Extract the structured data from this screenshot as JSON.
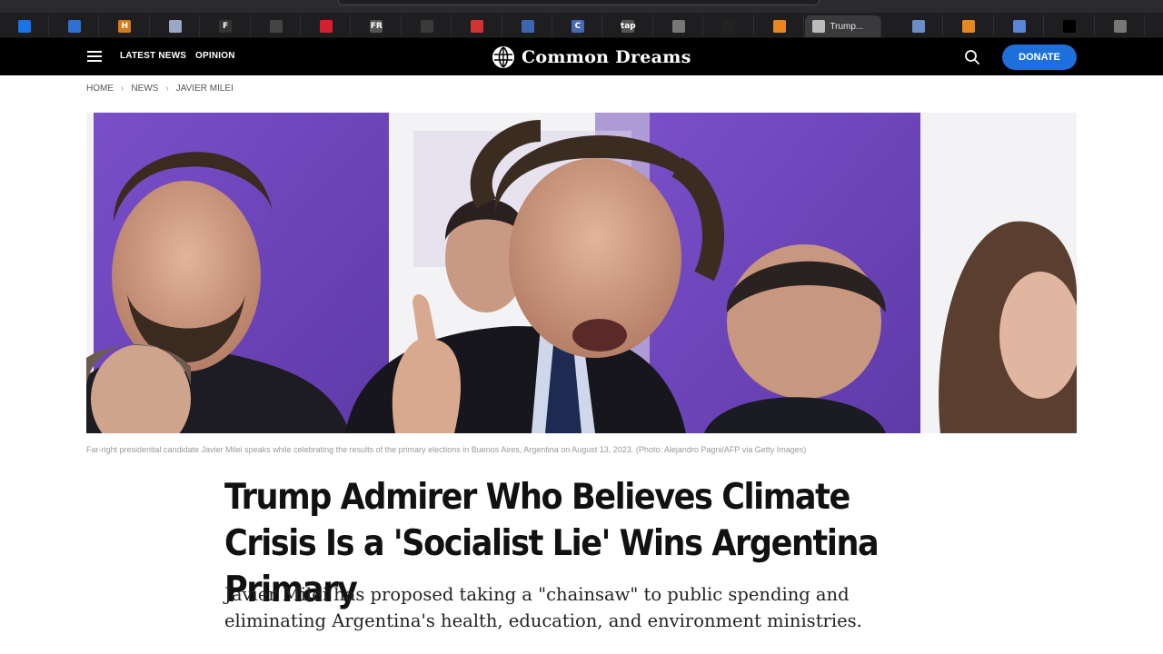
{
  "browser": {
    "tabs": [
      {
        "icon": "shield-icon",
        "color": "#1a73e8",
        "glyph": "",
        "active": false
      },
      {
        "icon": "shield-icon",
        "color": "#2f6fd6",
        "glyph": "",
        "active": false
      },
      {
        "icon": "h-logo-icon",
        "color": "#d77a1c",
        "glyph": "H",
        "active": false
      },
      {
        "icon": "news-icon",
        "color": "#9aa7c7",
        "glyph": "",
        "active": false
      },
      {
        "icon": "f-logo-icon",
        "color": "#333333",
        "glyph": "F",
        "active": false
      },
      {
        "icon": "newspaper-icon",
        "color": "#444444",
        "glyph": "",
        "active": false
      },
      {
        "icon": "red-logo-icon",
        "color": "#d5212f",
        "glyph": "",
        "active": false
      },
      {
        "icon": "fr-logo-icon",
        "color": "#555555",
        "glyph": "FR",
        "active": false
      },
      {
        "icon": "check-icon",
        "color": "#3a3a3a",
        "glyph": "",
        "active": false
      },
      {
        "icon": "red-square-icon",
        "color": "#d43333",
        "glyph": "",
        "active": false
      },
      {
        "icon": "book-icon",
        "color": "#3b67b0",
        "glyph": "",
        "active": false
      },
      {
        "icon": "c-logo-icon",
        "color": "#486ab3",
        "glyph": "C",
        "active": false
      },
      {
        "icon": "tap-logo-icon",
        "color": "#555555",
        "glyph": "tap",
        "active": false
      },
      {
        "icon": "globe-icon",
        "color": "#777777",
        "glyph": "",
        "active": false
      },
      {
        "icon": "dots-icon",
        "color": "#222222",
        "glyph": "",
        "active": false
      },
      {
        "icon": "orange-square-icon",
        "color": "#e8871e",
        "glyph": "",
        "active": false
      },
      {
        "icon": "common-dreams-icon",
        "color": "#bbbbbb",
        "glyph": "",
        "active": true,
        "title": "Trump..."
      },
      {
        "icon": "map-icon",
        "color": "#6a8ec5",
        "glyph": "",
        "active": false
      },
      {
        "icon": "orange-square-icon",
        "color": "#e8871e",
        "glyph": "",
        "active": false
      },
      {
        "icon": "stats-icon",
        "color": "#5a84d6",
        "glyph": "",
        "active": false
      },
      {
        "icon": "black-square-icon",
        "color": "#000000",
        "glyph": "",
        "active": false
      },
      {
        "icon": "gear-icon",
        "color": "#777777",
        "glyph": "",
        "active": false
      }
    ]
  },
  "header": {
    "nav": {
      "latest_news": "LATEST NEWS",
      "opinion": "OPINION"
    },
    "logo_text": "Common Dreams",
    "donate_label": "DONATE",
    "brand_color": "#1d6fdb"
  },
  "breadcrumb": [
    "HOME",
    "NEWS",
    "JAVIER MILEI"
  ],
  "article": {
    "caption": "Far-right presidential candidate Javier Milei speaks while celebrating the results of the primary elections in Buenos Aires, Argentina on August 13, 2023.   (Photo: Alejandro Pagni/AFP via Getty Images)",
    "headline": "Trump Admirer Who Believes Climate Crisis Is a 'Socialist Lie' Wins Argentina Primary",
    "dek": "Javier Milei has proposed taking a \"chainsaw\" to public spending and eliminating Argentina's health, education, and environment ministries."
  }
}
